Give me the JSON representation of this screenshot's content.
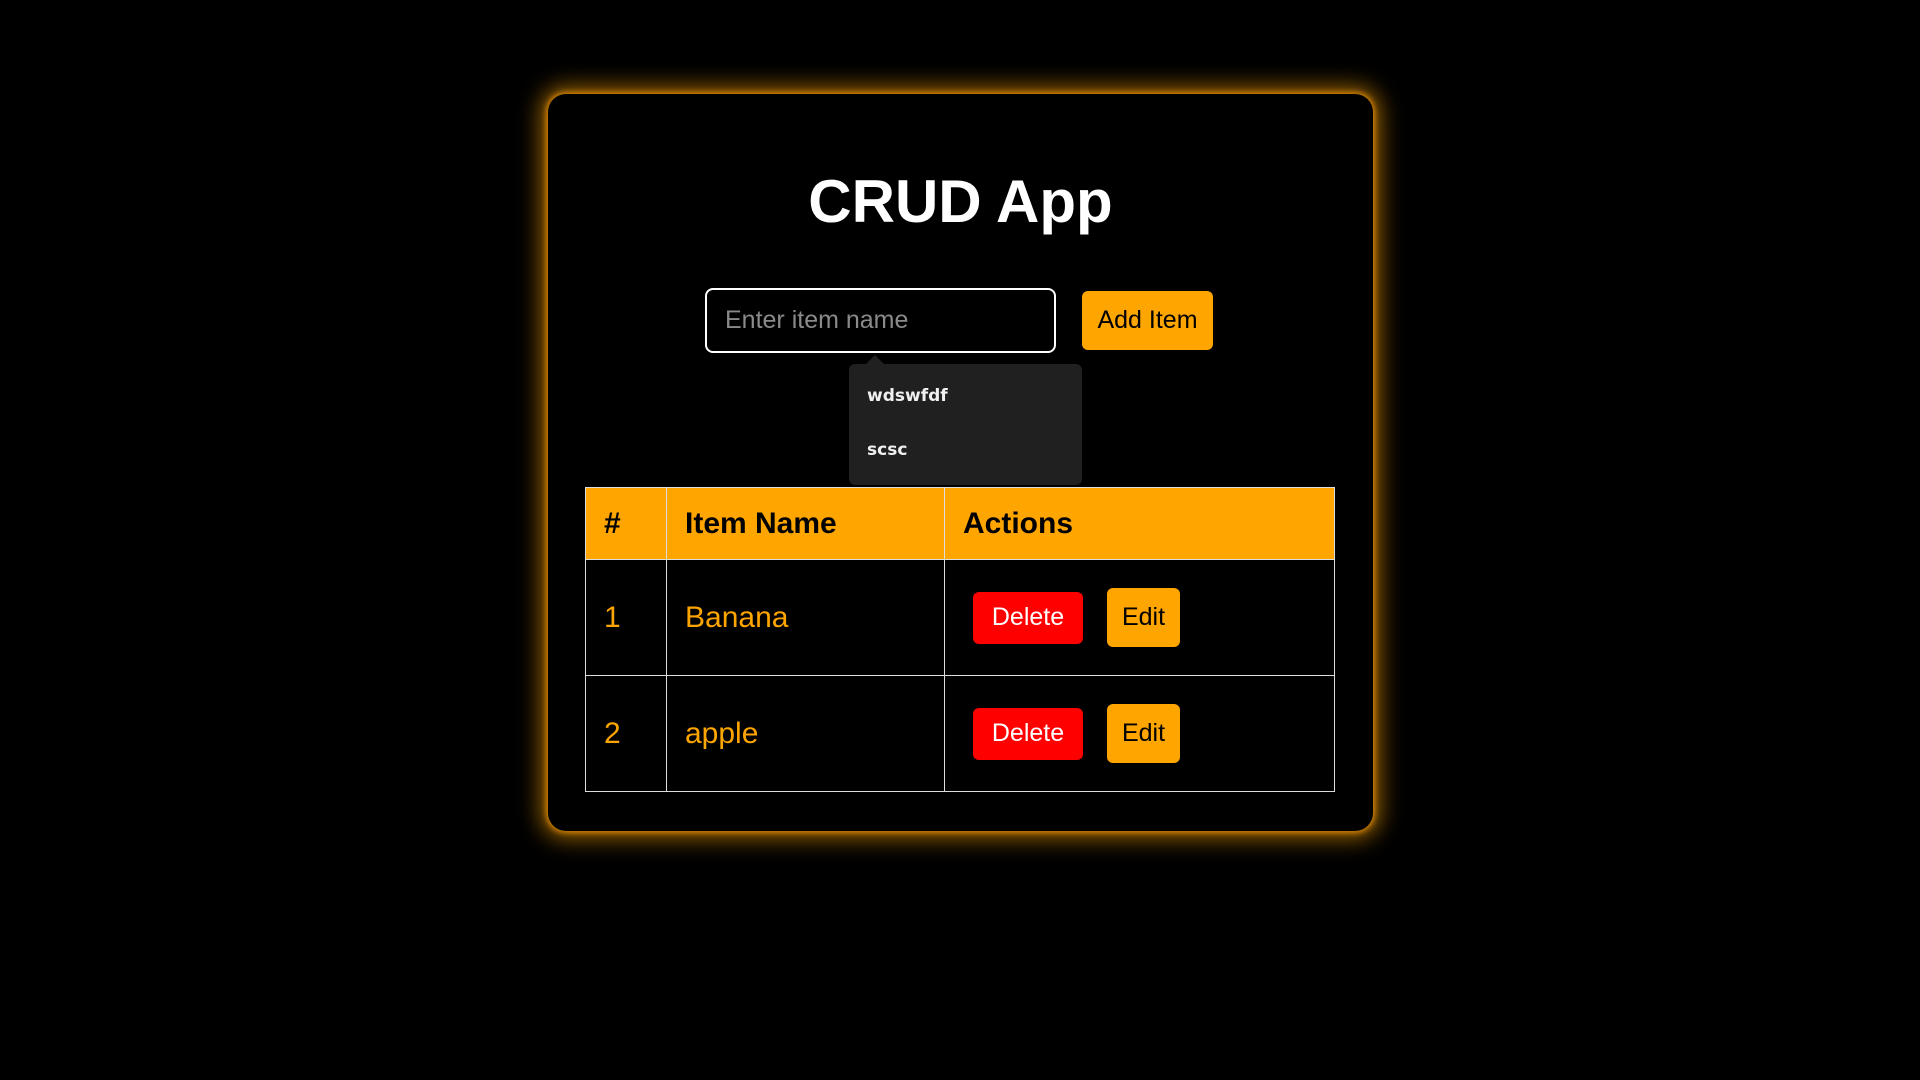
{
  "app": {
    "title": "CRUD App"
  },
  "form": {
    "input_value": "",
    "input_placeholder": "Enter item name",
    "add_button_label": "Add Item"
  },
  "autocomplete": {
    "suggestions": [
      "wdswfdf",
      "scsc"
    ]
  },
  "table": {
    "headers": [
      "#",
      "Item Name",
      "Actions"
    ],
    "rows": [
      {
        "number": "1",
        "name": "Banana",
        "delete_label": "Delete",
        "edit_label": "Edit"
      },
      {
        "number": "2",
        "name": "apple",
        "delete_label": "Delete",
        "edit_label": "Edit"
      }
    ]
  },
  "colors": {
    "background": "#000000",
    "accent": "#ffa500",
    "danger": "#ff0000",
    "text": "#ffffff"
  }
}
